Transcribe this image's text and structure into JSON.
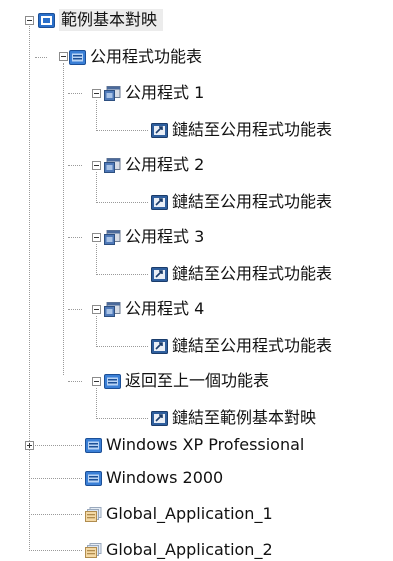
{
  "tree": {
    "root": {
      "label": "範例基本對映",
      "icon": "menu-map-icon"
    },
    "app_menu": {
      "label": "公用程式功能表",
      "icon": "menu-icon"
    },
    "apps": [
      {
        "label": "公用程式 1",
        "link": "鏈結至公用程式功能表",
        "icon": "application-icon",
        "link_icon": "link-icon"
      },
      {
        "label": "公用程式 2",
        "link": "鏈結至公用程式功能表",
        "icon": "application-icon",
        "link_icon": "link-icon"
      },
      {
        "label": "公用程式 3",
        "link": "鏈結至公用程式功能表",
        "icon": "application-icon",
        "link_icon": "link-icon"
      },
      {
        "label": "公用程式 4",
        "link": "鏈結至公用程式功能表",
        "icon": "application-icon",
        "link_icon": "link-icon"
      }
    ],
    "back": {
      "label": "返回至上一個功能表",
      "link": "鏈結至範例基本對映",
      "icon": "menu-icon",
      "link_icon": "link-icon"
    },
    "others": [
      {
        "label": "Windows XP Professional",
        "icon": "menu-icon",
        "collapsed": true
      },
      {
        "label": "Windows 2000",
        "icon": "menu-icon"
      },
      {
        "label": "Global_Application_1",
        "icon": "global-application-icon"
      },
      {
        "label": "Global_Application_2",
        "icon": "global-application-icon"
      }
    ]
  }
}
